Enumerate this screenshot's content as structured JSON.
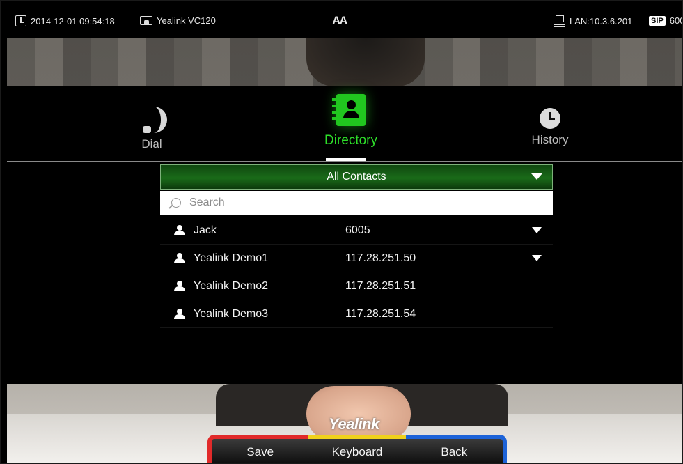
{
  "status_bar": {
    "datetime": "2014-12-01 09:54:18",
    "device_name": "Yealink VC120",
    "font_toggle": "AA",
    "lan": "LAN:10.3.6.201",
    "sip_badge": "SIP",
    "sip_account": "600"
  },
  "tabs": [
    {
      "label": "Dial",
      "icon": "phone-icon",
      "active": false
    },
    {
      "label": "Directory",
      "icon": "directory-icon",
      "active": true
    },
    {
      "label": "History",
      "icon": "clock-icon",
      "active": false
    }
  ],
  "directory": {
    "group_selected": "All Contacts",
    "search_placeholder": "Search",
    "contacts": [
      {
        "name": "Jack",
        "number": "6005",
        "has_more": true
      },
      {
        "name": "Yealink Demo1",
        "number": "117.28.251.50",
        "has_more": true
      },
      {
        "name": "Yealink Demo2",
        "number": "117.28.251.51",
        "has_more": false
      },
      {
        "name": "Yealink Demo3",
        "number": "117.28.251.54",
        "has_more": false
      }
    ]
  },
  "brand": "Yealink",
  "softkeys": {
    "save": "Save",
    "keyboard": "Keyboard",
    "back": "Back"
  },
  "colors": {
    "accent_green": "#21c61f",
    "softkey_red": "#e12a2a",
    "softkey_yellow": "#f0d11c",
    "softkey_blue": "#1d63d8"
  }
}
